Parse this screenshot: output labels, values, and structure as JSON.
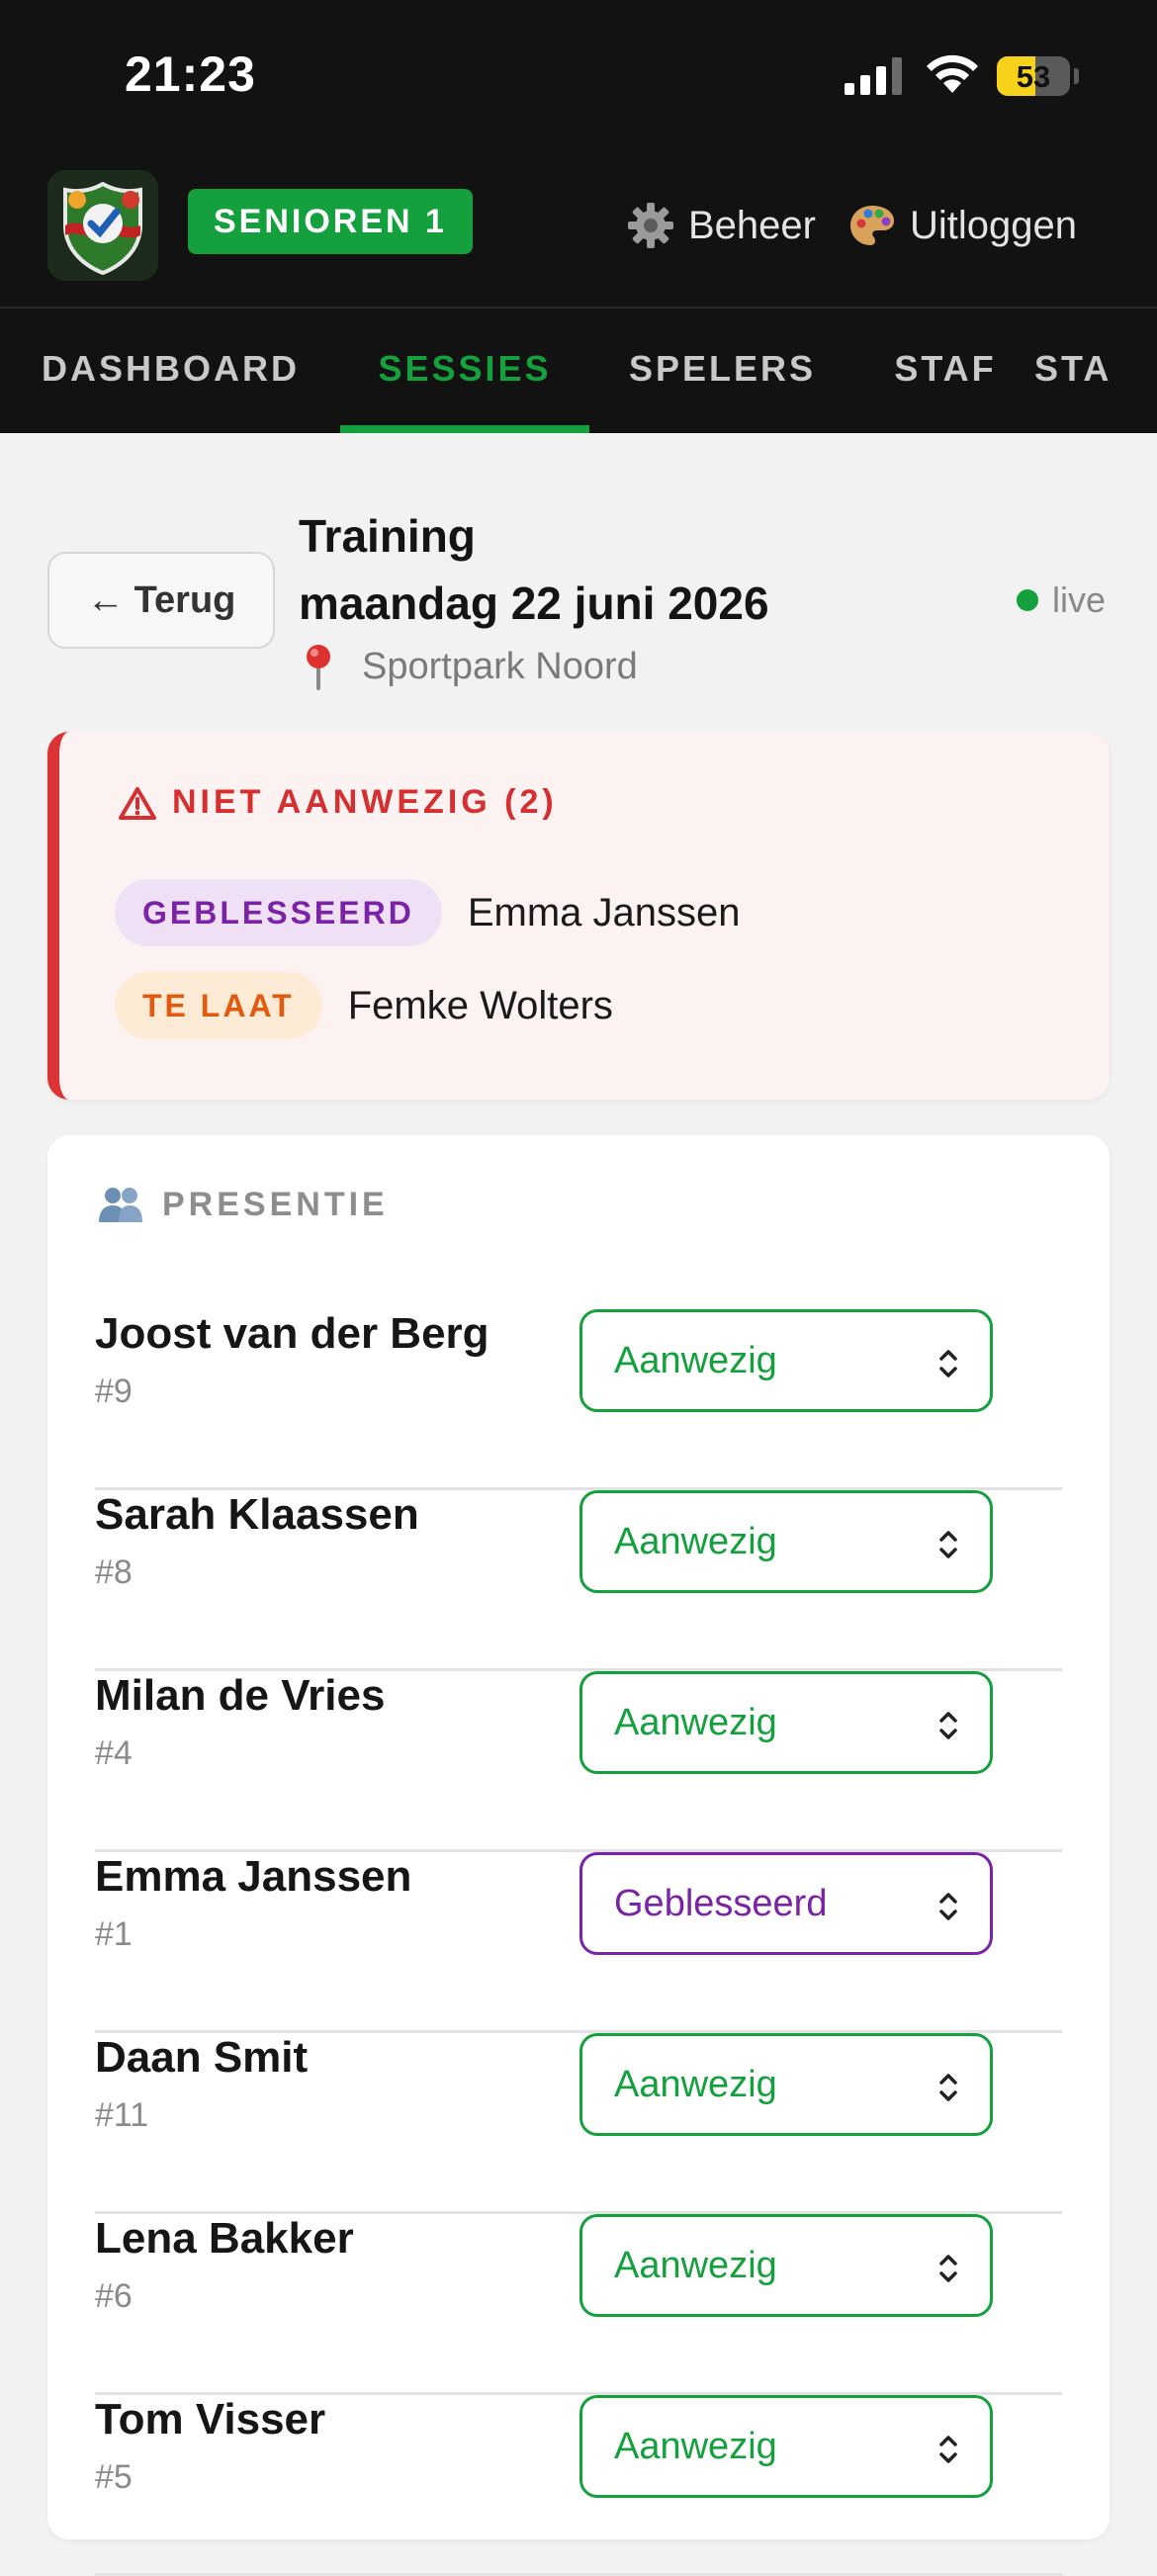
{
  "status_bar": {
    "time": "21:23",
    "battery": "53",
    "battery_level": 0.53
  },
  "header": {
    "team": "SENIOREN 1",
    "manage_label": "Beheer",
    "logout_label": "Uitloggen"
  },
  "tabs": [
    {
      "label": "DASHBOARD",
      "active": false
    },
    {
      "label": "SESSIES",
      "active": true
    },
    {
      "label": "SPELERS",
      "active": false
    },
    {
      "label": "STAF",
      "active": false
    },
    {
      "label": "STA",
      "active": false
    }
  ],
  "session": {
    "back_label": "Terug",
    "type": "Training",
    "date": "maandag 22 juni 2026",
    "location": "Sportpark Noord",
    "live_label": "live"
  },
  "absent": {
    "title": "NIET AANWEZIG (2)",
    "items": [
      {
        "status": "GEBLESSEERD",
        "name": "Emma Janssen"
      },
      {
        "status": "TE LAAT",
        "name": "Femke Wolters"
      }
    ]
  },
  "presence": {
    "title": "PRESENTIE",
    "players": [
      {
        "name": "Joost van der Berg",
        "number": "#9",
        "status": "Aanwezig"
      },
      {
        "name": "Sarah Klaassen",
        "number": "#8",
        "status": "Aanwezig"
      },
      {
        "name": "Milan de Vries",
        "number": "#4",
        "status": "Aanwezig"
      },
      {
        "name": "Emma Janssen",
        "number": "#1",
        "status": "Geblesseerd"
      },
      {
        "name": "Daan Smit",
        "number": "#11",
        "status": "Aanwezig"
      },
      {
        "name": "Lena Bakker",
        "number": "#6",
        "status": "Aanwezig"
      },
      {
        "name": "Tom Visser",
        "number": "#5",
        "status": "Aanwezig"
      }
    ]
  },
  "colors": {
    "brand_green": "#14a03d",
    "alert_red": "#dc3434",
    "injured_purple": "#7a23a6",
    "late_orange": "#e25a0f"
  }
}
